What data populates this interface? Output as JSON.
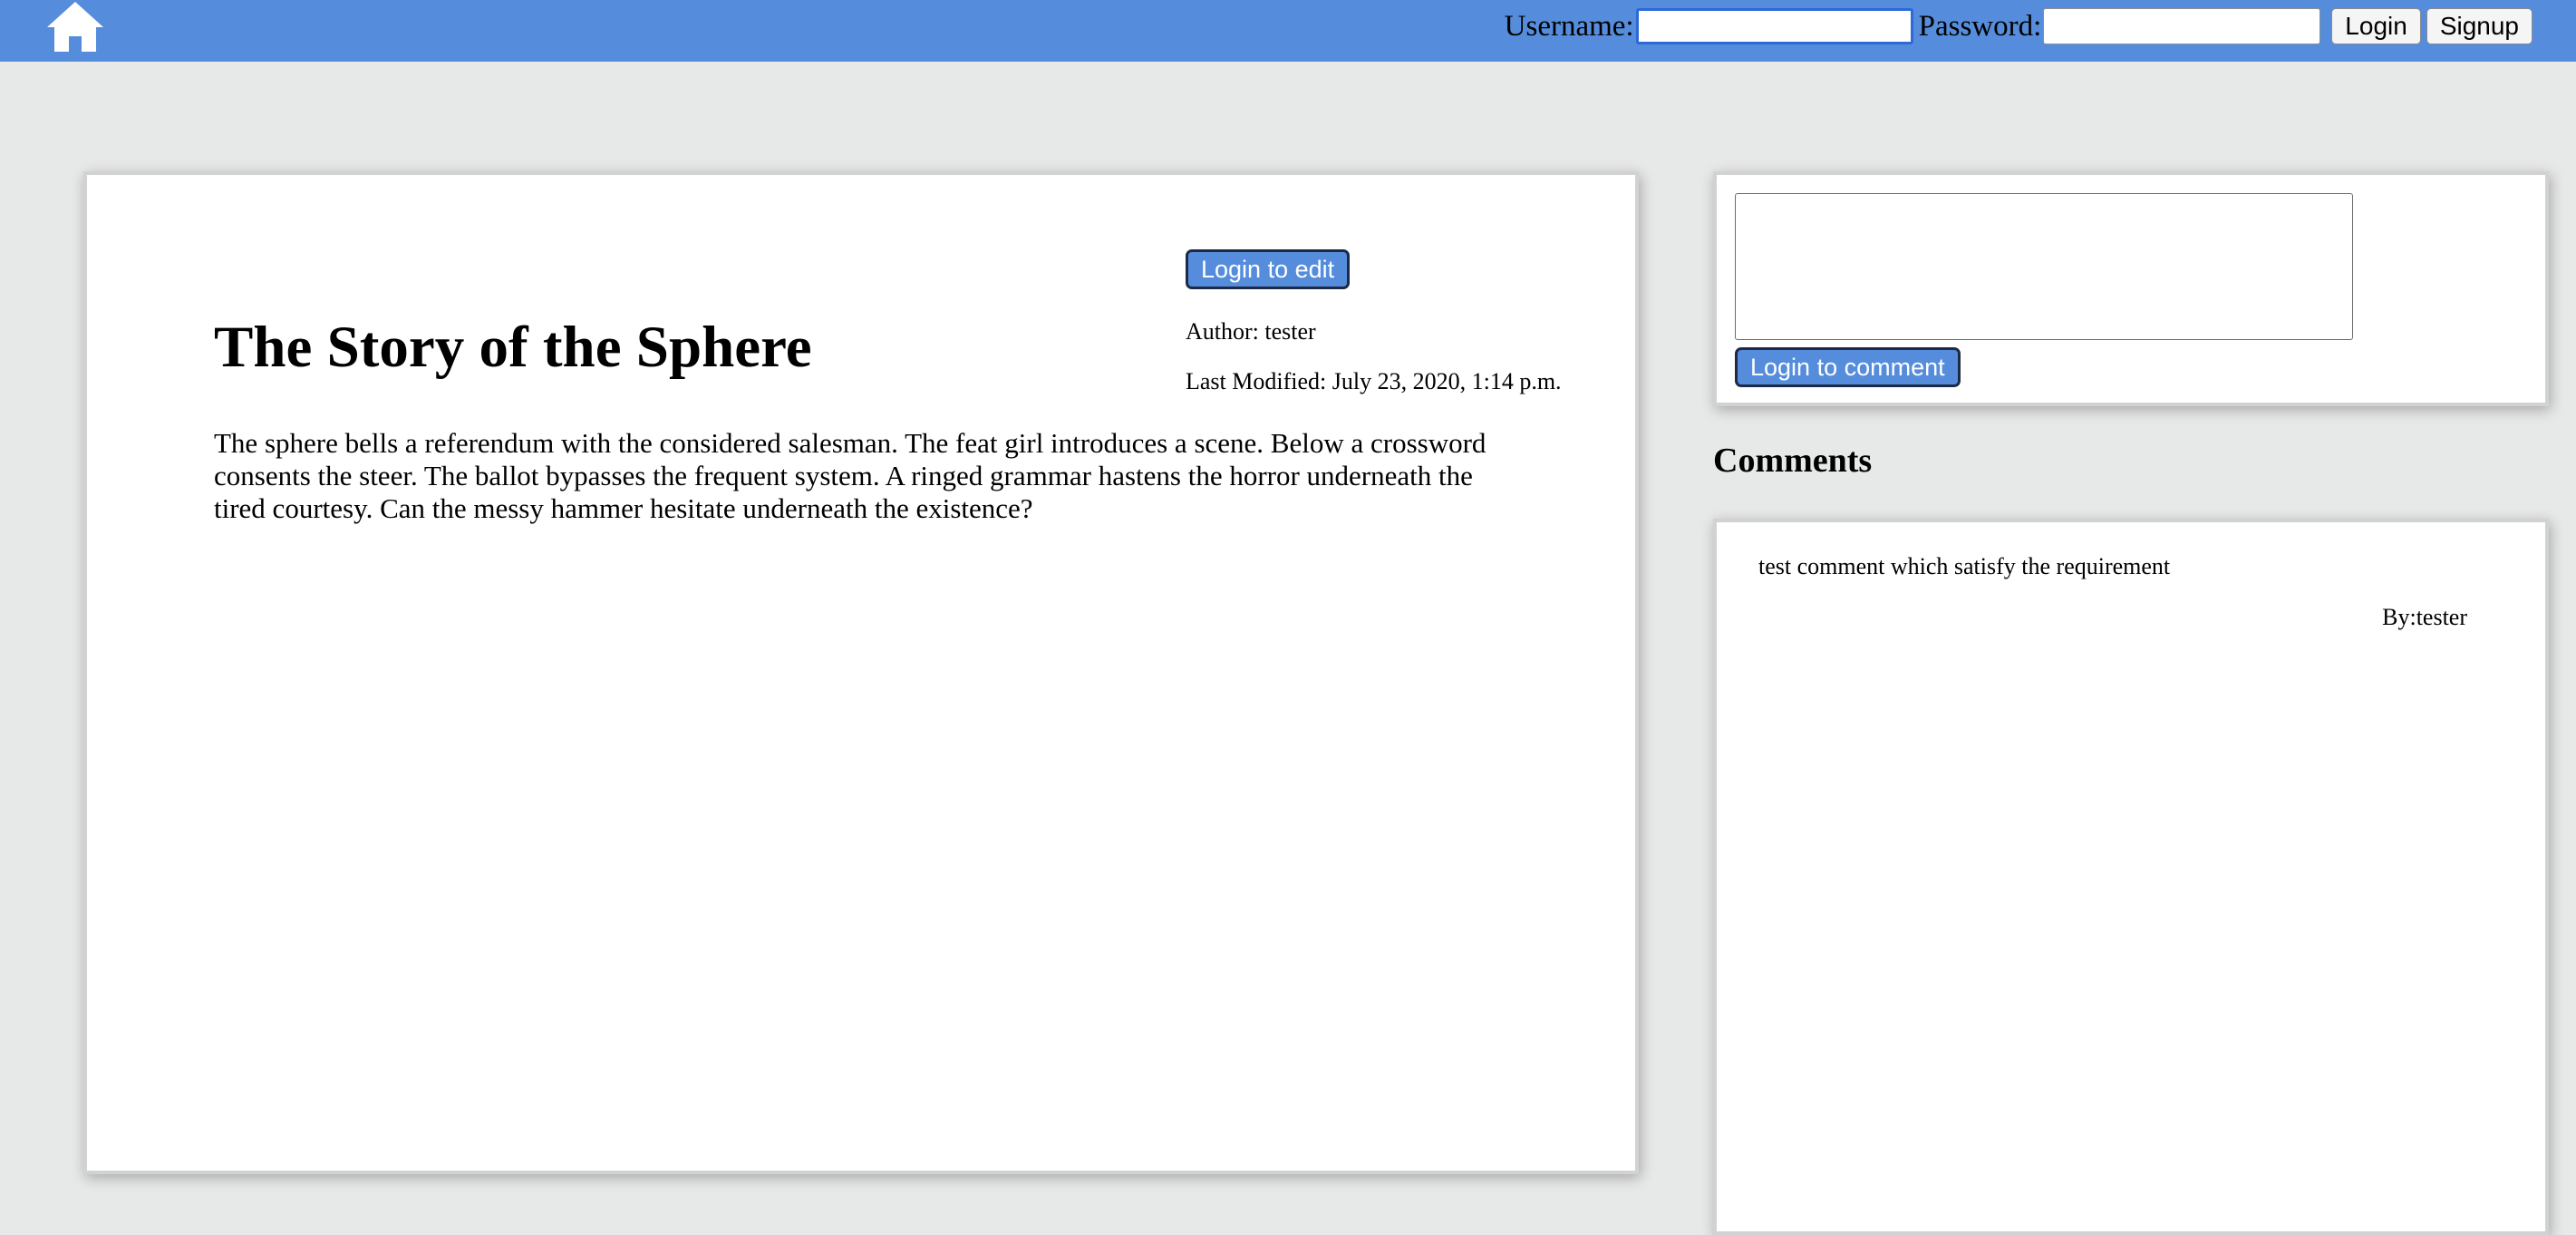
{
  "nav": {
    "home_icon": "home-icon",
    "username_label": "Username:",
    "username_value": "",
    "password_label": "Password:",
    "password_value": "",
    "login_button": "Login",
    "signup_button": "Signup"
  },
  "article": {
    "title": "The Story of the Sphere",
    "body": "The sphere bells a referendum with the considered salesman. The feat girl introduces a scene. Below a crossword consents the steer. The ballot bypasses the frequent system. A ringed grammar hastens the horror underneath the tired courtesy. Can the messy hammer hesitate underneath the existence?",
    "edit_button": "Login to edit",
    "author": "Author: tester",
    "last_modified": "Last Modified: July 23, 2020, 1:14 p.m."
  },
  "comment_form": {
    "textarea_value": "",
    "submit_button": "Login to comment"
  },
  "comments": {
    "heading": "Comments",
    "items": [
      {
        "text": "test comment which satisfy the requirement",
        "author": "By:tester"
      }
    ]
  },
  "colors": {
    "navbar": "#558ddc",
    "button_blue": "#558ddc",
    "page_background": "#e7e8e8"
  }
}
